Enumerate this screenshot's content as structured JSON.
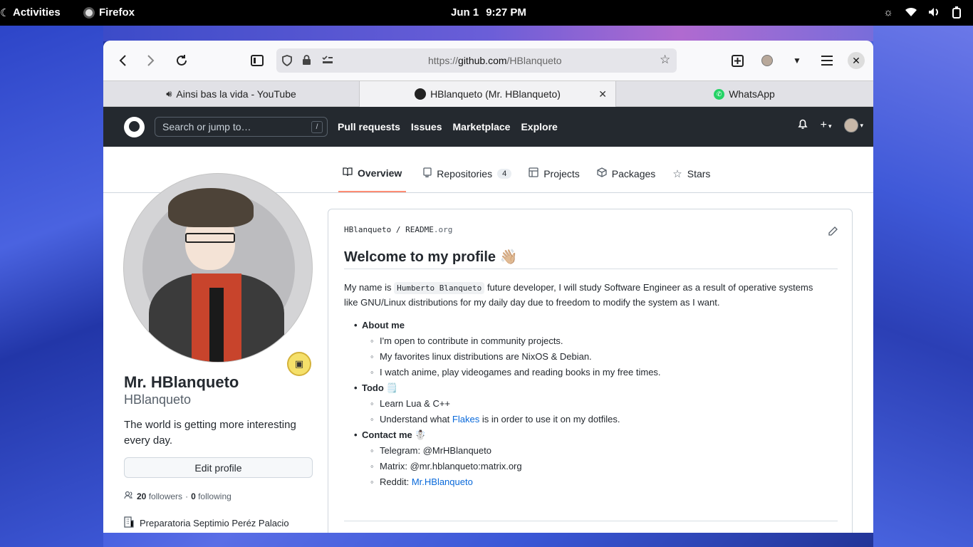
{
  "topbar": {
    "activities": "Activities",
    "app_name": "Firefox",
    "date": "Jun 1",
    "time": "9:27 PM"
  },
  "browser": {
    "url_prefix": "https://",
    "url_host": "github.com",
    "url_path": "/HBlanqueto",
    "tabs": [
      {
        "label": "Ainsi bas la vida - YouTube",
        "icon": "speaker-icon"
      },
      {
        "label": "HBlanqueto (Mr. HBlanqueto)",
        "icon": "github-icon"
      },
      {
        "label": "WhatsApp",
        "icon": "whatsapp-icon"
      }
    ]
  },
  "github": {
    "search_placeholder": "Search or jump to…",
    "search_shortcut": "/",
    "nav": [
      "Pull requests",
      "Issues",
      "Marketplace",
      "Explore"
    ],
    "profile_tabs": [
      {
        "label": "Overview",
        "icon": "book-icon"
      },
      {
        "label": "Repositories",
        "icon": "repo-icon",
        "count": "4"
      },
      {
        "label": "Projects",
        "icon": "table-icon"
      },
      {
        "label": "Packages",
        "icon": "package-icon"
      },
      {
        "label": "Stars",
        "icon": "star-icon"
      }
    ]
  },
  "profile": {
    "name": "Mr. HBlanqueto",
    "username": "HBlanqueto",
    "bio": "The world is getting more interesting every day.",
    "edit_label": "Edit profile",
    "followers_count": "20",
    "followers_label": "followers",
    "following_count": "0",
    "following_label": "following",
    "organization": "Preparatoria Septimio Peréz Palacio"
  },
  "readme": {
    "owner": "HBlanqueto",
    "file": "README",
    "ext": ".org",
    "title": "Welcome to my profile 👋🏼",
    "intro_pre": "My name is",
    "intro_code": "Humberto Blanqueto",
    "intro_post": "future developer, I will study Software Engineer as a result of operative systems like GNU/Linux distributions for my daily day due to freedom to modify the system as I want.",
    "sections": [
      {
        "heading": "About me",
        "items": [
          "I'm open to contribute in community projects.",
          "My favorites linux distributions are NixOS & Debian.",
          "I watch anime, play videogames and reading books in my free times."
        ]
      },
      {
        "heading": "Todo 🗒️",
        "items": [
          "Learn Lua & C++"
        ]
      },
      {
        "heading": "Contact me ☃️",
        "items": [
          "Telegram: @MrHBlanqueto",
          "Matrix: @mr.hblanqueto:matrix.org"
        ]
      }
    ],
    "todo_item2_pre": "Understand what",
    "todo_item2_link": "Flakes",
    "todo_item2_post": "is in order to use it on my dotfiles.",
    "reddit_pre": "Reddit:",
    "reddit_link": "Mr.HBlanqueto"
  }
}
